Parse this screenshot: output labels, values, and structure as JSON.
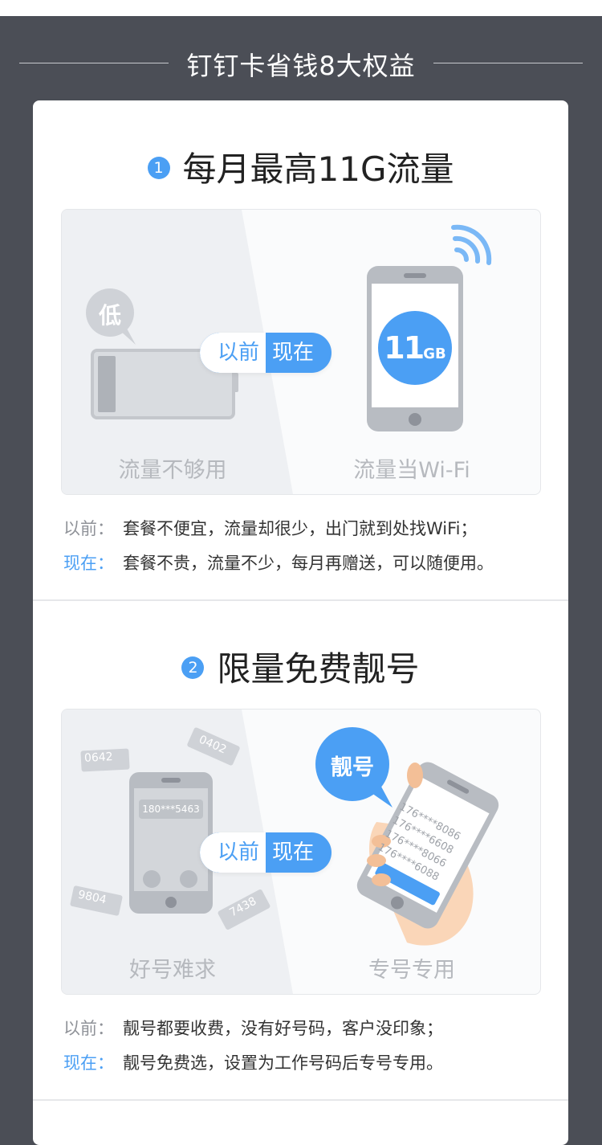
{
  "header": {
    "title": "钉钉卡省钱8大权益"
  },
  "sections": [
    {
      "number": "1",
      "title": "每月最高11G流量",
      "pill": {
        "before": "以前",
        "now": "现在"
      },
      "left_caption": "流量不够用",
      "right_caption": "流量当Wi-Fi",
      "badge_low": "低",
      "gb_big": "11",
      "gb_small": "GB",
      "notes": [
        {
          "key": "以前：",
          "text": "套餐不便宜，流量却很少，出门就到处找WiFi；"
        },
        {
          "key": "现在：",
          "text": "套餐不贵，流量不少，每月再赠送，可以随便用。"
        }
      ]
    },
    {
      "number": "2",
      "title": "限量免费靓号",
      "pill": {
        "before": "以前",
        "now": "现在"
      },
      "left_caption": "好号难求",
      "right_caption": "专号专用",
      "bubble": "靓号",
      "scattered_numbers": [
        "0642",
        "0402",
        "9804",
        "7438"
      ],
      "phone_number": "180***5463",
      "list_numbers": [
        "176****8086",
        "176****6608",
        "176****8066",
        "176****6088"
      ],
      "notes": [
        {
          "key": "以前：",
          "text": "靓号都要收费，没有好号码，客户没印象；"
        },
        {
          "key": "现在：",
          "text": "靓号免费选，设置为工作号码后专号专用。"
        }
      ]
    }
  ],
  "colors": {
    "background": "#4b4e56",
    "card": "#ffffff",
    "accent": "#4b9ff4",
    "muted": "#b6b9be"
  }
}
